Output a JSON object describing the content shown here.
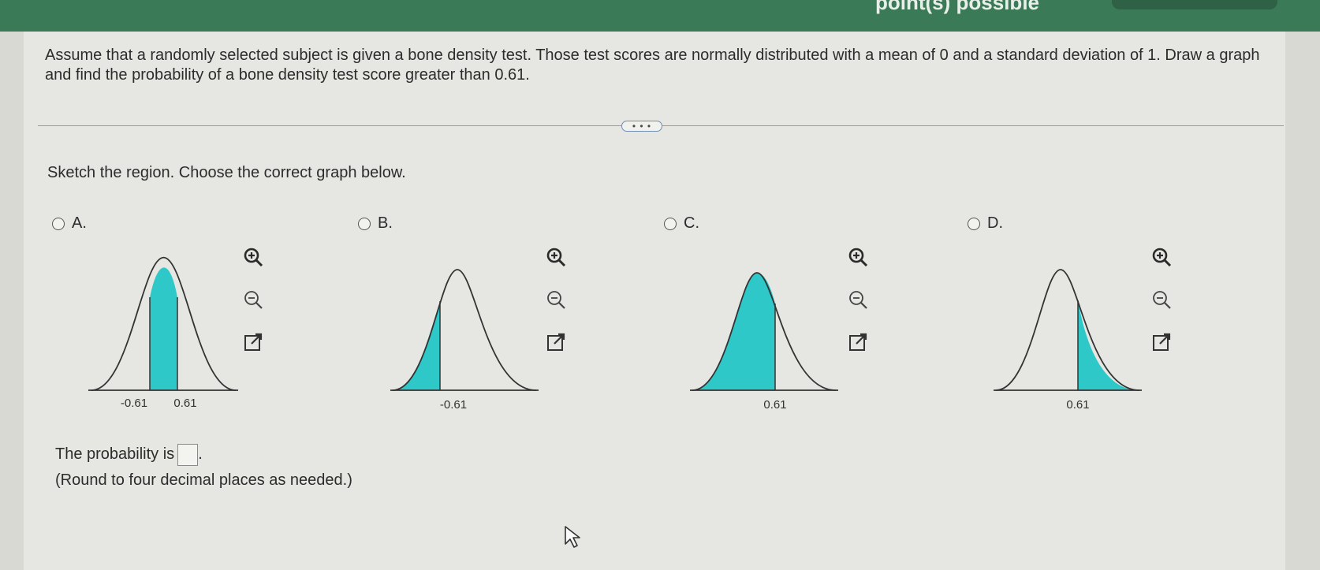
{
  "header": {
    "points_text": "point(s) possible"
  },
  "question": {
    "text": "Assume that a randomly selected subject is given a bone density test. Those test scores are normally distributed with a mean of 0 and a standard deviation of 1. Draw a graph and find the probability of a bone density test score greater than 0.61."
  },
  "more_button": {
    "label": "• • •"
  },
  "instruction": "Sketch the region. Choose the correct graph below.",
  "options": [
    {
      "letter": "A.",
      "labels": [
        "-0.61",
        "0.61"
      ]
    },
    {
      "letter": "B.",
      "labels": [
        "-0.61"
      ]
    },
    {
      "letter": "C.",
      "labels": [
        "0.61"
      ]
    },
    {
      "letter": "D.",
      "labels": [
        "0.61"
      ]
    }
  ],
  "icons": [
    "zoom-in-icon",
    "zoom-out-icon",
    "open-new-window-icon"
  ],
  "answer": {
    "prefix": "The probability is",
    "suffix": ".",
    "note": "(Round to four decimal places as needed.)",
    "value": ""
  },
  "colors": {
    "fill": "#2ec8c8",
    "header": "#3b7a57",
    "curve": "#333333"
  }
}
